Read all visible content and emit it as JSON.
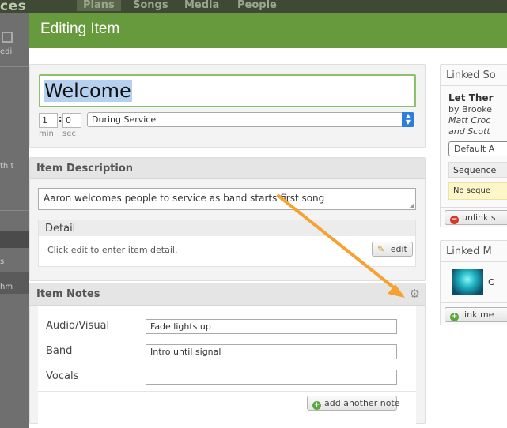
{
  "background_app": {
    "logo": "ces",
    "nav": [
      "Plans",
      "Songs",
      "Media",
      "People"
    ],
    "left_fragments": [
      "edi",
      "th t",
      "s",
      "hm"
    ]
  },
  "modal": {
    "title": "Editing Item"
  },
  "item": {
    "title": "Welcome",
    "length_min": "1",
    "length_sec": "0",
    "min_label": "min",
    "sec_label": "sec",
    "timing_option": "During Service"
  },
  "description": {
    "header": "Item Description",
    "text": "Aaron welcomes people to service as band starts first song",
    "detail_header": "Detail",
    "detail_placeholder": "Click edit to enter item detail.",
    "edit_label": "edit"
  },
  "notes": {
    "header": "Item Notes",
    "rows": [
      {
        "label": "Audio/Visual",
        "value": "Fade lights up"
      },
      {
        "label": "Band",
        "value": "Intro until signal"
      },
      {
        "label": "Vocals",
        "value": ""
      }
    ],
    "add_label": "add another note"
  },
  "linked_song": {
    "header": "Linked So",
    "song_title": "Let Ther",
    "by_line": "by Brooke",
    "authors_line1": "Matt Croc",
    "authors_line2": "and Scott",
    "arrangement_button": "Default A",
    "sequence_label": "Sequence",
    "sequence_warning": "No seque",
    "unlink_label": "unlink s"
  },
  "linked_media": {
    "header": "Linked M",
    "item_fragment": "C",
    "link_label": "link me"
  },
  "colors": {
    "header_green": "#679a3d",
    "annotation_arrow": "#f5a233",
    "select_blue": "#2c7ddf"
  }
}
